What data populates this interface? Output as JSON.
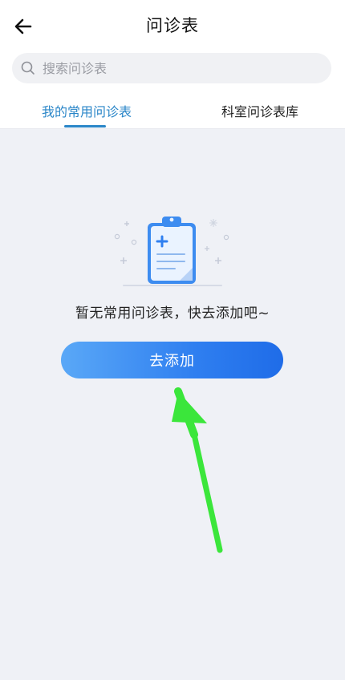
{
  "header": {
    "title": "问诊表",
    "back_icon": "arrow-left-icon"
  },
  "search": {
    "placeholder": "搜索问诊表",
    "value": "",
    "icon": "search-icon"
  },
  "tabs": [
    {
      "label": "我的常用问诊表",
      "active": true
    },
    {
      "label": "科室问诊表库",
      "active": false
    }
  ],
  "empty_state": {
    "illustration": "clipboard-icon",
    "message": "暂无常用问诊表，快去添加吧~",
    "button_label": "去添加"
  },
  "annotation": {
    "type": "green-arrow",
    "color": "#3be63b"
  },
  "colors": {
    "accent": "#2a86c8",
    "background": "#eff1f6",
    "button_start": "#5aa8f7",
    "button_end": "#1f6ce8"
  }
}
